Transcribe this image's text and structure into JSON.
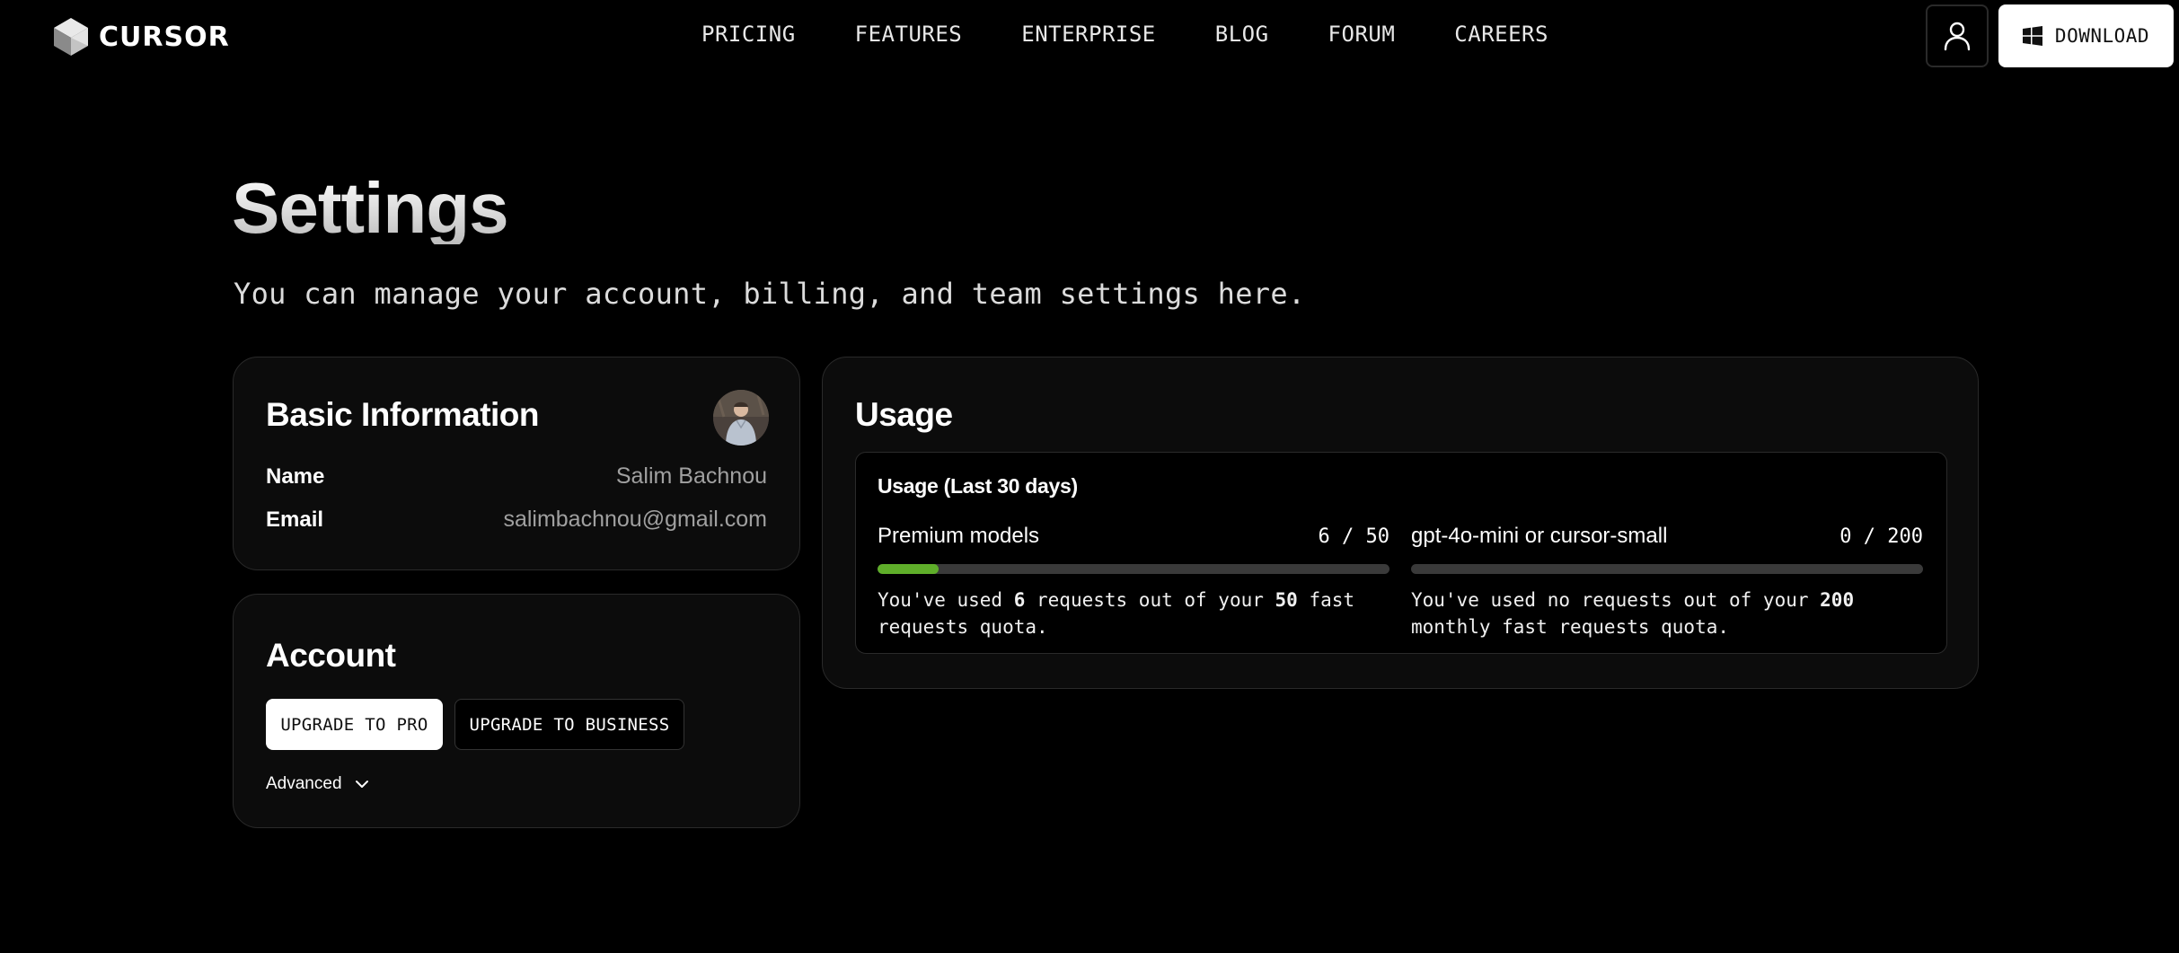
{
  "brand": {
    "name": "CURSOR"
  },
  "nav": {
    "links": [
      "PRICING",
      "FEATURES",
      "ENTERPRISE",
      "BLOG",
      "FORUM",
      "CAREERS"
    ],
    "user_icon": "user-icon",
    "download_label": "DOWNLOAD",
    "download_icon": "windows-icon"
  },
  "page": {
    "title": "Settings",
    "subtitle": "You can manage your account, billing, and team settings here."
  },
  "basic_info": {
    "title": "Basic Information",
    "name_label": "Name",
    "name_value": "Salim Bachnou",
    "email_label": "Email",
    "email_value": "salimbachnou@gmail.com"
  },
  "account": {
    "title": "Account",
    "upgrade_pro_label": "UPGRADE TO PRO",
    "upgrade_business_label": "UPGRADE TO BUSINESS",
    "advanced_label": "Advanced"
  },
  "usage": {
    "title": "Usage",
    "period_title": "Usage (Last 30 days)",
    "quotas": [
      {
        "model": "Premium models",
        "count": "6 / 50",
        "used": 6,
        "limit": 50,
        "desc_1": "You've used ",
        "desc_used": "6",
        "desc_2": " requests out of your ",
        "desc_limit": "50",
        "desc_3": " fast requests quota."
      },
      {
        "model": "gpt-4o-mini or cursor-small",
        "count": "0 / 200",
        "used": 0,
        "limit": 200,
        "desc_1": "You've used no requests out of your ",
        "desc_limit": "200",
        "desc_2": " monthly fast requests quota."
      }
    ]
  },
  "colors": {
    "background": "#000000",
    "card": "#0c0c0c",
    "progress_fill": "#5fae2a",
    "progress_track": "#3a3a3a"
  }
}
